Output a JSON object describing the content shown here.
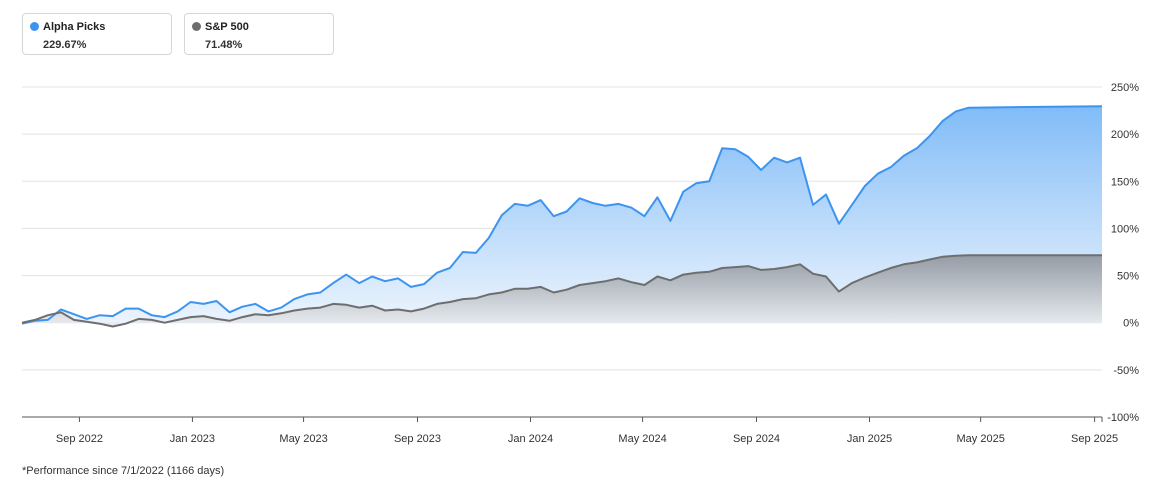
{
  "legend": {
    "items": [
      {
        "name": "Alpha Picks",
        "value": "229.67%",
        "color": "#3d94f0"
      },
      {
        "name": "S&P 500",
        "value": "71.48%",
        "color": "#6e6e6e"
      }
    ]
  },
  "footnote": "*Performance since 7/1/2022 (1166 days)",
  "chart_data": {
    "type": "area",
    "x_start": "2022-07-01",
    "x_end": "2025-09-09",
    "x_ticks": [
      {
        "label": "Sep 2022",
        "date": "2022-09-01"
      },
      {
        "label": "Jan 2023",
        "date": "2023-01-01"
      },
      {
        "label": "May 2023",
        "date": "2023-05-01"
      },
      {
        "label": "Sep 2023",
        "date": "2023-09-01"
      },
      {
        "label": "Jan 2024",
        "date": "2024-01-01"
      },
      {
        "label": "May 2024",
        "date": "2024-05-01"
      },
      {
        "label": "Sep 2024",
        "date": "2024-09-01"
      },
      {
        "label": "Jan 2025",
        "date": "2025-01-01"
      },
      {
        "label": "May 2025",
        "date": "2025-05-01"
      },
      {
        "label": "Sep 2025",
        "date": "2025-09-01"
      }
    ],
    "y_ticks": [
      {
        "value": 250,
        "label": "250%"
      },
      {
        "value": 200,
        "label": "200%"
      },
      {
        "value": 150,
        "label": "150%"
      },
      {
        "value": 100,
        "label": "100%"
      },
      {
        "value": 50,
        "label": "50%"
      },
      {
        "value": 0,
        "label": "0%"
      },
      {
        "value": -50,
        "label": "-50%"
      },
      {
        "value": -100,
        "label": "-100%"
      }
    ],
    "ylim": [
      -100,
      250
    ],
    "grid": true,
    "legend_position": "top-left",
    "series": [
      {
        "name": "Alpha Picks",
        "color": "#3d94f0",
        "points": [
          [
            "2022-07-01",
            -1
          ],
          [
            "2022-07-15",
            2
          ],
          [
            "2022-07-29",
            3
          ],
          [
            "2022-08-12",
            14
          ],
          [
            "2022-08-26",
            9
          ],
          [
            "2022-09-09",
            4
          ],
          [
            "2022-09-23",
            8
          ],
          [
            "2022-10-07",
            7
          ],
          [
            "2022-10-21",
            15
          ],
          [
            "2022-11-04",
            15
          ],
          [
            "2022-11-18",
            8
          ],
          [
            "2022-12-02",
            6
          ],
          [
            "2022-12-16",
            12
          ],
          [
            "2022-12-30",
            22
          ],
          [
            "2023-01-13",
            20
          ],
          [
            "2023-01-27",
            23
          ],
          [
            "2023-02-10",
            11
          ],
          [
            "2023-02-24",
            17
          ],
          [
            "2023-03-10",
            20
          ],
          [
            "2023-03-24",
            12
          ],
          [
            "2023-04-07",
            16
          ],
          [
            "2023-04-21",
            25
          ],
          [
            "2023-05-05",
            30
          ],
          [
            "2023-05-19",
            32
          ],
          [
            "2023-06-02",
            42
          ],
          [
            "2023-06-16",
            51
          ],
          [
            "2023-06-30",
            42
          ],
          [
            "2023-07-14",
            49
          ],
          [
            "2023-07-28",
            44
          ],
          [
            "2023-08-11",
            47
          ],
          [
            "2023-08-25",
            38
          ],
          [
            "2023-09-08",
            41
          ],
          [
            "2023-09-22",
            53
          ],
          [
            "2023-10-06",
            58
          ],
          [
            "2023-10-20",
            75
          ],
          [
            "2023-11-03",
            74
          ],
          [
            "2023-11-17",
            90
          ],
          [
            "2023-12-01",
            114
          ],
          [
            "2023-12-15",
            126
          ],
          [
            "2023-12-29",
            124
          ],
          [
            "2024-01-12",
            130
          ],
          [
            "2024-01-26",
            113
          ],
          [
            "2024-02-09",
            118
          ],
          [
            "2024-02-23",
            132
          ],
          [
            "2024-03-08",
            127
          ],
          [
            "2024-03-22",
            124
          ],
          [
            "2024-04-05",
            126
          ],
          [
            "2024-04-19",
            122
          ],
          [
            "2024-05-03",
            113
          ],
          [
            "2024-05-17",
            133
          ],
          [
            "2024-05-31",
            108
          ],
          [
            "2024-06-14",
            139
          ],
          [
            "2024-06-28",
            148
          ],
          [
            "2024-07-12",
            150
          ],
          [
            "2024-07-26",
            185
          ],
          [
            "2024-08-09",
            184
          ],
          [
            "2024-08-23",
            176
          ],
          [
            "2024-09-06",
            162
          ],
          [
            "2024-09-20",
            175
          ],
          [
            "2024-10-04",
            170
          ],
          [
            "2024-10-18",
            175
          ],
          [
            "2024-11-01",
            125
          ],
          [
            "2024-11-15",
            136
          ],
          [
            "2024-11-29",
            105
          ],
          [
            "2024-12-13",
            125
          ],
          [
            "2024-12-27",
            145
          ],
          [
            "2025-01-10",
            158
          ],
          [
            "2025-01-24",
            165
          ],
          [
            "2025-02-07",
            177
          ],
          [
            "2025-02-21",
            185
          ],
          [
            "2025-03-07",
            198
          ],
          [
            "2025-03-21",
            214
          ],
          [
            "2025-04-04",
            224
          ],
          [
            "2025-04-18",
            228
          ],
          [
            "2025-09-09",
            229.67
          ]
        ]
      },
      {
        "name": "S&P 500",
        "color": "#6e6e6e",
        "points": [
          [
            "2022-07-01",
            0
          ],
          [
            "2022-07-15",
            3
          ],
          [
            "2022-07-29",
            8
          ],
          [
            "2022-08-12",
            11
          ],
          [
            "2022-08-26",
            3
          ],
          [
            "2022-09-09",
            1
          ],
          [
            "2022-09-23",
            -1
          ],
          [
            "2022-10-07",
            -4
          ],
          [
            "2022-10-21",
            -1
          ],
          [
            "2022-11-04",
            4
          ],
          [
            "2022-11-18",
            3
          ],
          [
            "2022-12-02",
            0
          ],
          [
            "2022-12-16",
            3
          ],
          [
            "2022-12-30",
            6
          ],
          [
            "2023-01-13",
            7
          ],
          [
            "2023-01-27",
            4
          ],
          [
            "2023-02-10",
            2
          ],
          [
            "2023-02-24",
            6
          ],
          [
            "2023-03-10",
            9
          ],
          [
            "2023-03-24",
            8
          ],
          [
            "2023-04-07",
            10
          ],
          [
            "2023-04-21",
            13
          ],
          [
            "2023-05-05",
            15
          ],
          [
            "2023-05-19",
            16
          ],
          [
            "2023-06-02",
            20
          ],
          [
            "2023-06-16",
            19
          ],
          [
            "2023-06-30",
            16
          ],
          [
            "2023-07-14",
            18
          ],
          [
            "2023-07-28",
            13
          ],
          [
            "2023-08-11",
            14
          ],
          [
            "2023-08-25",
            12
          ],
          [
            "2023-09-08",
            15
          ],
          [
            "2023-09-22",
            20
          ],
          [
            "2023-10-06",
            22
          ],
          [
            "2023-10-20",
            25
          ],
          [
            "2023-11-03",
            26
          ],
          [
            "2023-11-17",
            30
          ],
          [
            "2023-12-01",
            32
          ],
          [
            "2023-12-15",
            36
          ],
          [
            "2023-12-29",
            36
          ],
          [
            "2024-01-12",
            38
          ],
          [
            "2024-01-26",
            32
          ],
          [
            "2024-02-09",
            35
          ],
          [
            "2024-02-23",
            40
          ],
          [
            "2024-03-08",
            42
          ],
          [
            "2024-03-22",
            44
          ],
          [
            "2024-04-05",
            47
          ],
          [
            "2024-04-19",
            43
          ],
          [
            "2024-05-03",
            40
          ],
          [
            "2024-05-17",
            49
          ],
          [
            "2024-05-31",
            45
          ],
          [
            "2024-06-14",
            51
          ],
          [
            "2024-06-28",
            53
          ],
          [
            "2024-07-12",
            54
          ],
          [
            "2024-07-26",
            58
          ],
          [
            "2024-08-09",
            59
          ],
          [
            "2024-08-23",
            60
          ],
          [
            "2024-09-06",
            56
          ],
          [
            "2024-09-20",
            57
          ],
          [
            "2024-10-04",
            59
          ],
          [
            "2024-10-18",
            62
          ],
          [
            "2024-11-01",
            52
          ],
          [
            "2024-11-15",
            49
          ],
          [
            "2024-11-29",
            33
          ],
          [
            "2024-12-13",
            42
          ],
          [
            "2024-12-27",
            48
          ],
          [
            "2025-01-10",
            53
          ],
          [
            "2025-01-24",
            58
          ],
          [
            "2025-02-07",
            62
          ],
          [
            "2025-02-21",
            64
          ],
          [
            "2025-03-07",
            67
          ],
          [
            "2025-03-21",
            70
          ],
          [
            "2025-04-04",
            71
          ],
          [
            "2025-04-18",
            71.5
          ],
          [
            "2025-09-09",
            71.48
          ]
        ]
      }
    ]
  }
}
